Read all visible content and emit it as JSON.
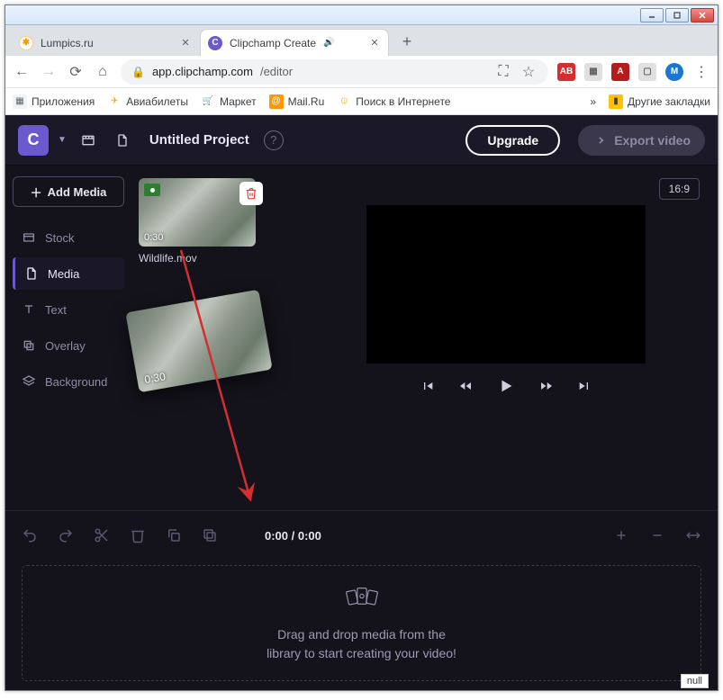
{
  "window": {
    "title": "Clipchamp Create"
  },
  "browser": {
    "tabs": [
      {
        "title": "Lumpics.ru",
        "favicon": "orange"
      },
      {
        "title": "Clipchamp Create",
        "favicon": "purple",
        "audio": true
      }
    ],
    "url_domain": "app.clipchamp.com",
    "url_path": "/editor"
  },
  "bookmarks": {
    "apps": "Приложения",
    "avia": "Авиабилеты",
    "market": "Маркет",
    "mail": "Mail.Ru",
    "search": "Поиск в Интернете",
    "more": "»",
    "other": "Другие закладки"
  },
  "topbar": {
    "logo": "C",
    "project_title": "Untitled Project",
    "upgrade": "Upgrade",
    "export": "Export video"
  },
  "sidebar": {
    "add_media": "Add Media",
    "items": [
      {
        "label": "Stock"
      },
      {
        "label": "Media"
      },
      {
        "label": "Text"
      },
      {
        "label": "Overlay"
      },
      {
        "label": "Background"
      }
    ]
  },
  "media": {
    "thumb_duration": "0:30",
    "thumb_name": "Wildlife.mov",
    "ghost_duration": "0:30"
  },
  "preview": {
    "ratio": "16:9"
  },
  "timeline": {
    "time": "0:00 / 0:00",
    "drop_line1": "Drag and drop media from the",
    "drop_line2": "library to start creating your video!"
  },
  "misc": {
    "null": "null"
  }
}
